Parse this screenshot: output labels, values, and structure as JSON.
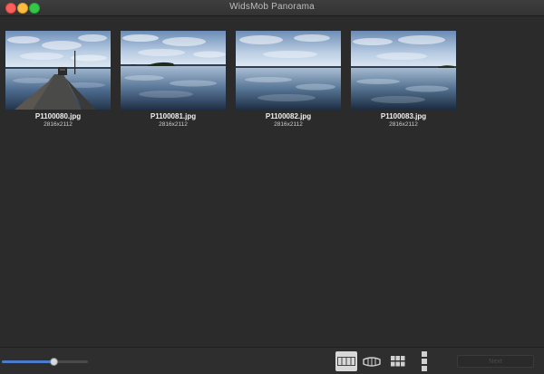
{
  "window": {
    "title": "WidsMob Panorama"
  },
  "photos": [
    {
      "filename": "P1100080.jpg",
      "dimensions": "2816x2112"
    },
    {
      "filename": "P1100081.jpg",
      "dimensions": "2816x2112"
    },
    {
      "filename": "P1100082.jpg",
      "dimensions": "2816x2112"
    },
    {
      "filename": "P1100083.jpg",
      "dimensions": "2816x2112"
    }
  ],
  "toolbar": {
    "zoom_level": 0.6,
    "modes": [
      "horizontal-panorama-icon",
      "360-panorama-icon",
      "tile-panorama-icon",
      "vertical-panorama-icon"
    ],
    "active_mode": "horizontal-panorama-icon",
    "action_label": "Next"
  },
  "colors": {
    "background": "#2b2b2b",
    "accent": "#4a7cc7",
    "active_mode": "#d8d8d8"
  }
}
